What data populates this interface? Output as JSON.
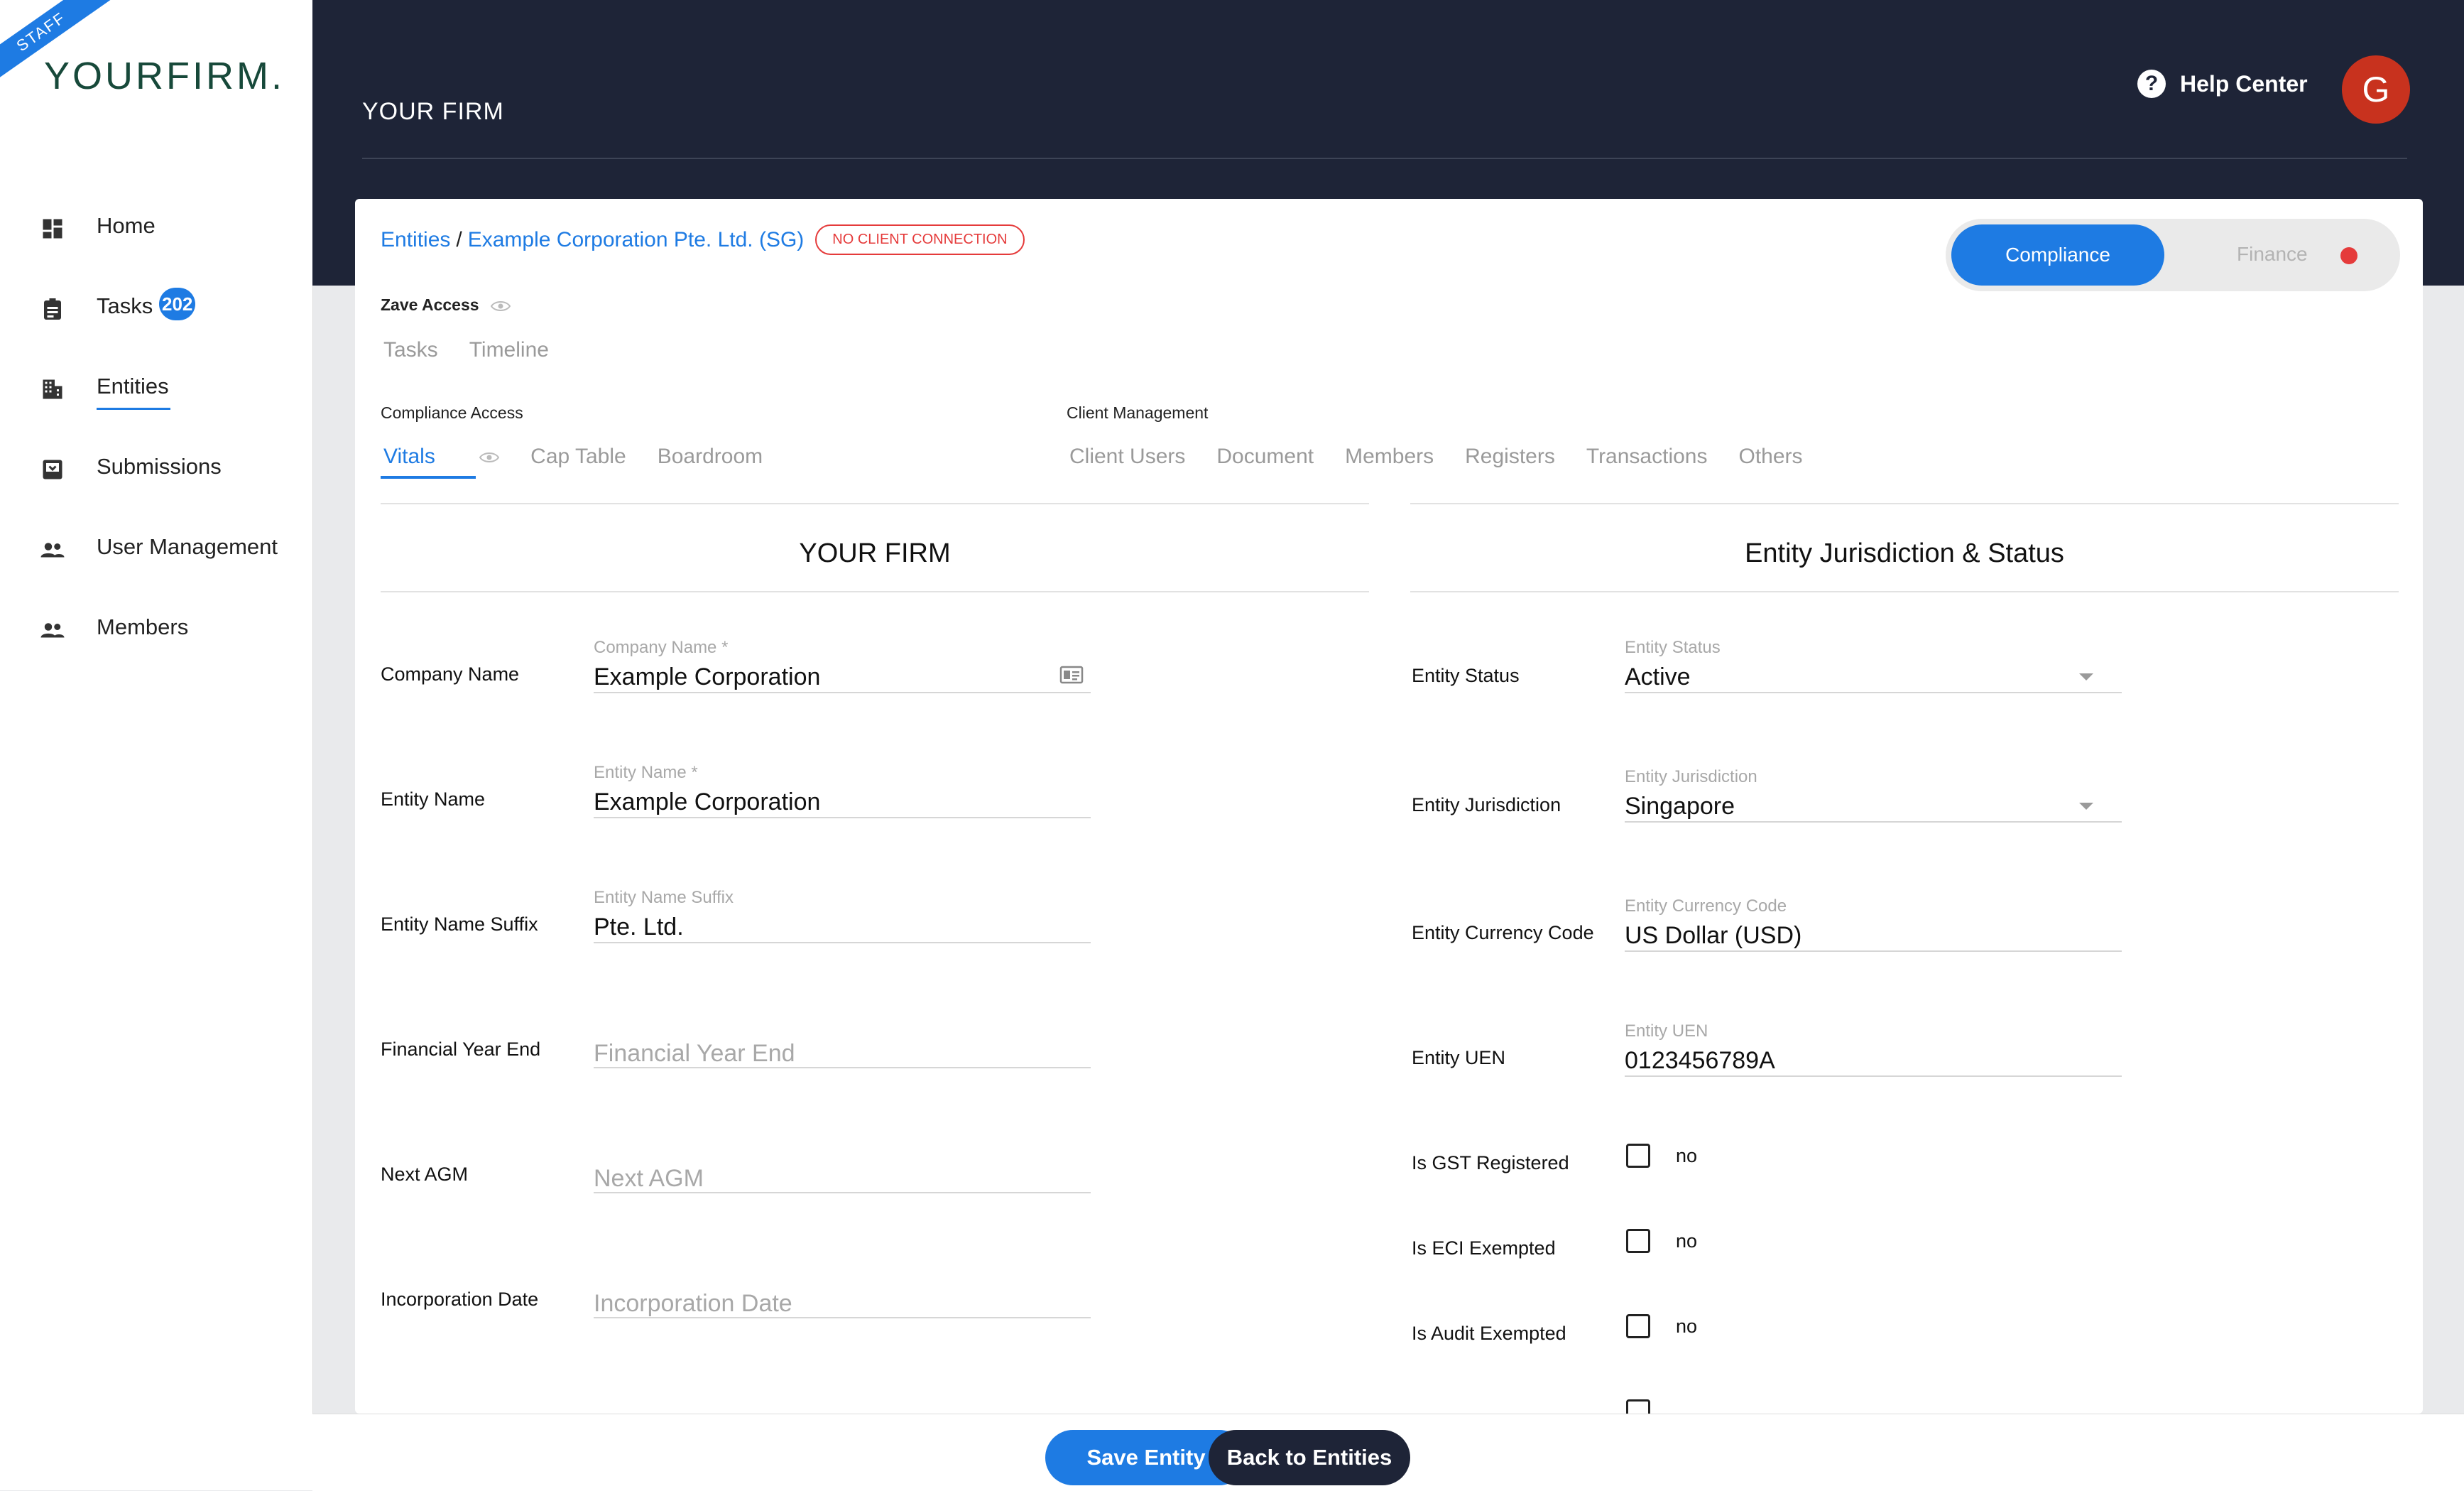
{
  "brand": {
    "ribbon": "STAFF",
    "logo": "YOURFIRM."
  },
  "sidebar": {
    "items": [
      {
        "label": "Home",
        "icon": "dashboard-icon"
      },
      {
        "label": "Tasks",
        "icon": "clipboard-icon",
        "badge": "202"
      },
      {
        "label": "Entities",
        "icon": "building-icon",
        "active": true
      },
      {
        "label": "Submissions",
        "icon": "inbox-icon"
      },
      {
        "label": "User Management",
        "icon": "people-icon"
      },
      {
        "label": "Members",
        "icon": "people-icon"
      }
    ]
  },
  "header": {
    "firm_title": "YOUR FIRM",
    "help_label": "Help Center",
    "help_icon": "?",
    "avatar_initial": "G"
  },
  "breadcrumb": {
    "root": "Entities",
    "separator": "/",
    "current": "Example Corporation Pte. Ltd. (SG)",
    "status_chip": "NO CLIENT CONNECTION"
  },
  "toggle": {
    "active": "Compliance",
    "inactive": "Finance"
  },
  "zave_access": {
    "label": "Zave Access",
    "tabs": [
      "Tasks",
      "Timeline"
    ]
  },
  "compliance_access": {
    "label": "Compliance Access",
    "tabs": [
      "Vitals",
      "Cap Table",
      "Boardroom"
    ]
  },
  "client_management": {
    "label": "Client Management",
    "tabs": [
      "Client Users",
      "Document",
      "Members",
      "Registers",
      "Transactions",
      "Others"
    ]
  },
  "left_section": {
    "title": "YOUR FIRM",
    "rows": [
      {
        "label": "Company Name",
        "field_label": "Company Name *",
        "value": "Example Corporation",
        "placeholder": ""
      },
      {
        "label": "Entity Name",
        "field_label": "Entity Name *",
        "value": "Example Corporation",
        "placeholder": ""
      },
      {
        "label": "Entity Name Suffix",
        "field_label": "Entity Name Suffix",
        "value": "Pte. Ltd.",
        "placeholder": ""
      },
      {
        "label": "Financial Year End",
        "field_label": "",
        "value": "",
        "placeholder": "Financial Year End"
      },
      {
        "label": "Next AGM",
        "field_label": "",
        "value": "",
        "placeholder": "Next AGM"
      },
      {
        "label": "Incorporation Date",
        "field_label": "",
        "value": "",
        "placeholder": "Incorporation Date"
      }
    ]
  },
  "right_section": {
    "title": "Entity Jurisdiction & Status",
    "rows": [
      {
        "label": "Entity Status",
        "field_label": "Entity Status",
        "value": "Active"
      },
      {
        "label": "Entity Jurisdiction",
        "field_label": "Entity Jurisdiction",
        "value": "Singapore"
      },
      {
        "label": "Entity Currency Code",
        "field_label": "Entity Currency Code",
        "value": "US Dollar (USD)"
      },
      {
        "label": "Entity UEN",
        "field_label": "Entity UEN",
        "value": "0123456789A"
      }
    ],
    "checks": [
      {
        "label": "Is GST Registered",
        "value": "no"
      },
      {
        "label": "Is ECI Exempted",
        "value": "no"
      },
      {
        "label": "Is Audit Exempted",
        "value": "no"
      }
    ]
  },
  "actions": {
    "save": "Save Entity",
    "back": "Back to Entities"
  },
  "colors": {
    "accent": "#1e7be3",
    "navy": "#1e2437",
    "danger": "#e53b3b",
    "logo": "#17493a"
  }
}
